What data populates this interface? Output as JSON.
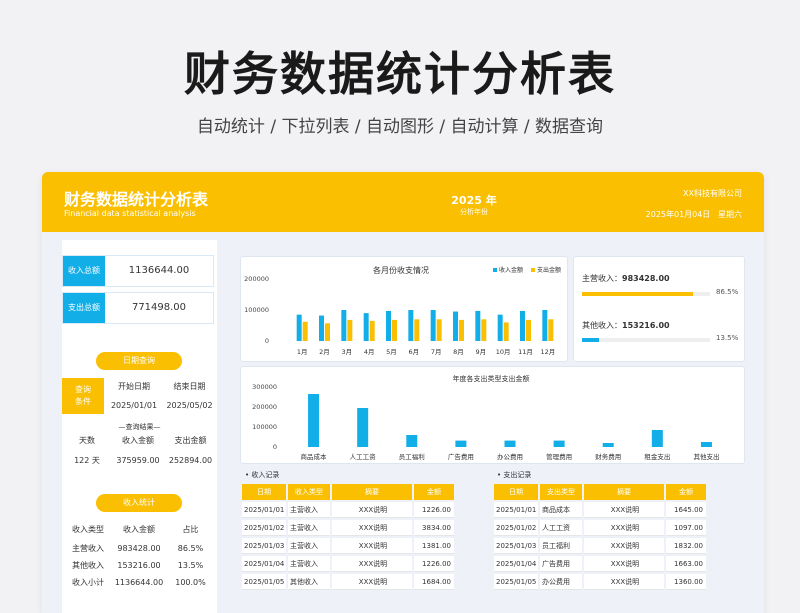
{
  "banner": {
    "title": "财务数据统计分析表",
    "subtitle": "自动统计 / 下拉列表 / 自动图形 / 自动计算 / 数据查询"
  },
  "header": {
    "title": "财务数据统计分析表",
    "subtitle_en": "Financial data statistical analysis",
    "year": "2025 年",
    "year_label": "分析年份",
    "company": "XX科技有限公司",
    "date": "2025年01月04日",
    "weekday": "星期六"
  },
  "kpis": [
    {
      "label": "收入总额",
      "value": "1136644.00"
    },
    {
      "label": "支出总额",
      "value": "771498.00"
    }
  ],
  "query": {
    "pill": "日期查询",
    "cond_label": "查询\n条件",
    "start_label": "开始日期",
    "end_label": "结束日期",
    "start": "2025/01/01",
    "end": "2025/05/02",
    "result_label": "—查询结果—",
    "days_label": "天数",
    "income_label": "收入金额",
    "expense_label": "支出金额",
    "days": "122 天",
    "income": "375959.00",
    "expense": "252894.00"
  },
  "income_stats": {
    "pill": "收入统计",
    "headers": [
      "收入类型",
      "收入金额",
      "占比"
    ],
    "rows": [
      [
        "主营收入",
        "983428.00",
        "86.5%"
      ],
      [
        "其他收入",
        "153216.00",
        "13.5%"
      ],
      [
        "收入小计",
        "1136644.00",
        "100.0%"
      ]
    ]
  },
  "income_split": {
    "main_label": "主营收入：",
    "main_value": "983428.00",
    "main_pct": "86.5%",
    "main_frac": 0.865,
    "other_label": "其他收入：",
    "other_value": "153216.00",
    "other_pct": "13.5%",
    "other_frac": 0.135,
    "main_color": "#f9bf00",
    "other_color": "#12aee8"
  },
  "chart_data": [
    {
      "type": "bar",
      "title": "各月份收支情况",
      "categories": [
        "1月",
        "2月",
        "3月",
        "4月",
        "5月",
        "6月",
        "7月",
        "8月",
        "9月",
        "10月",
        "11月",
        "12月"
      ],
      "series": [
        {
          "name": "收入金额",
          "color": "#12aee8",
          "values": [
            85000,
            82000,
            100000,
            90000,
            97000,
            100000,
            100000,
            95000,
            97000,
            85000,
            97000,
            100000
          ]
        },
        {
          "name": "支出金额",
          "color": "#f9bf00",
          "values": [
            62000,
            57000,
            68000,
            65000,
            68000,
            70000,
            70000,
            68000,
            70000,
            60000,
            68000,
            70000
          ]
        }
      ],
      "yticks": [
        "0",
        "100000",
        "200000"
      ],
      "ylim": [
        0,
        200000
      ],
      "legend": "top-right"
    },
    {
      "type": "bar",
      "title": "年度各支出类型支出金额",
      "categories": [
        "商品成本",
        "人工工资",
        "员工福利",
        "广告费用",
        "办公费用",
        "管理费用",
        "财务费用",
        "租金支出",
        "其他支出"
      ],
      "series": [
        {
          "color": "#12aee8",
          "values": [
            265000,
            195000,
            60000,
            32000,
            32000,
            32000,
            20000,
            85000,
            25000
          ]
        }
      ],
      "yticks": [
        "0",
        "100000",
        "200000",
        "300000"
      ],
      "ylim": [
        0,
        300000
      ]
    }
  ],
  "income_record": {
    "title": "• 收入记录",
    "headers": [
      "日期",
      "收入类型",
      "摘要",
      "金额"
    ],
    "rows": [
      [
        "2025/01/01",
        "主营收入",
        "XXX说明",
        "1226.00"
      ],
      [
        "2025/01/02",
        "主营收入",
        "XXX说明",
        "3834.00"
      ],
      [
        "2025/01/03",
        "主营收入",
        "XXX说明",
        "1381.00"
      ],
      [
        "2025/01/04",
        "主营收入",
        "XXX说明",
        "1226.00"
      ],
      [
        "2025/01/05",
        "其他收入",
        "XXX说明",
        "1684.00"
      ]
    ]
  },
  "expense_record": {
    "title": "• 支出记录",
    "headers": [
      "日期",
      "支出类型",
      "摘要",
      "金额"
    ],
    "rows": [
      [
        "2025/01/01",
        "商品成本",
        "XXX说明",
        "1645.00"
      ],
      [
        "2025/01/02",
        "人工工资",
        "XXX说明",
        "1097.00"
      ],
      [
        "2025/01/03",
        "员工福利",
        "XXX说明",
        "1832.00"
      ],
      [
        "2025/01/04",
        "广告费用",
        "XXX说明",
        "1663.00"
      ],
      [
        "2025/01/05",
        "办公费用",
        "XXX说明",
        "1360.00"
      ]
    ]
  }
}
